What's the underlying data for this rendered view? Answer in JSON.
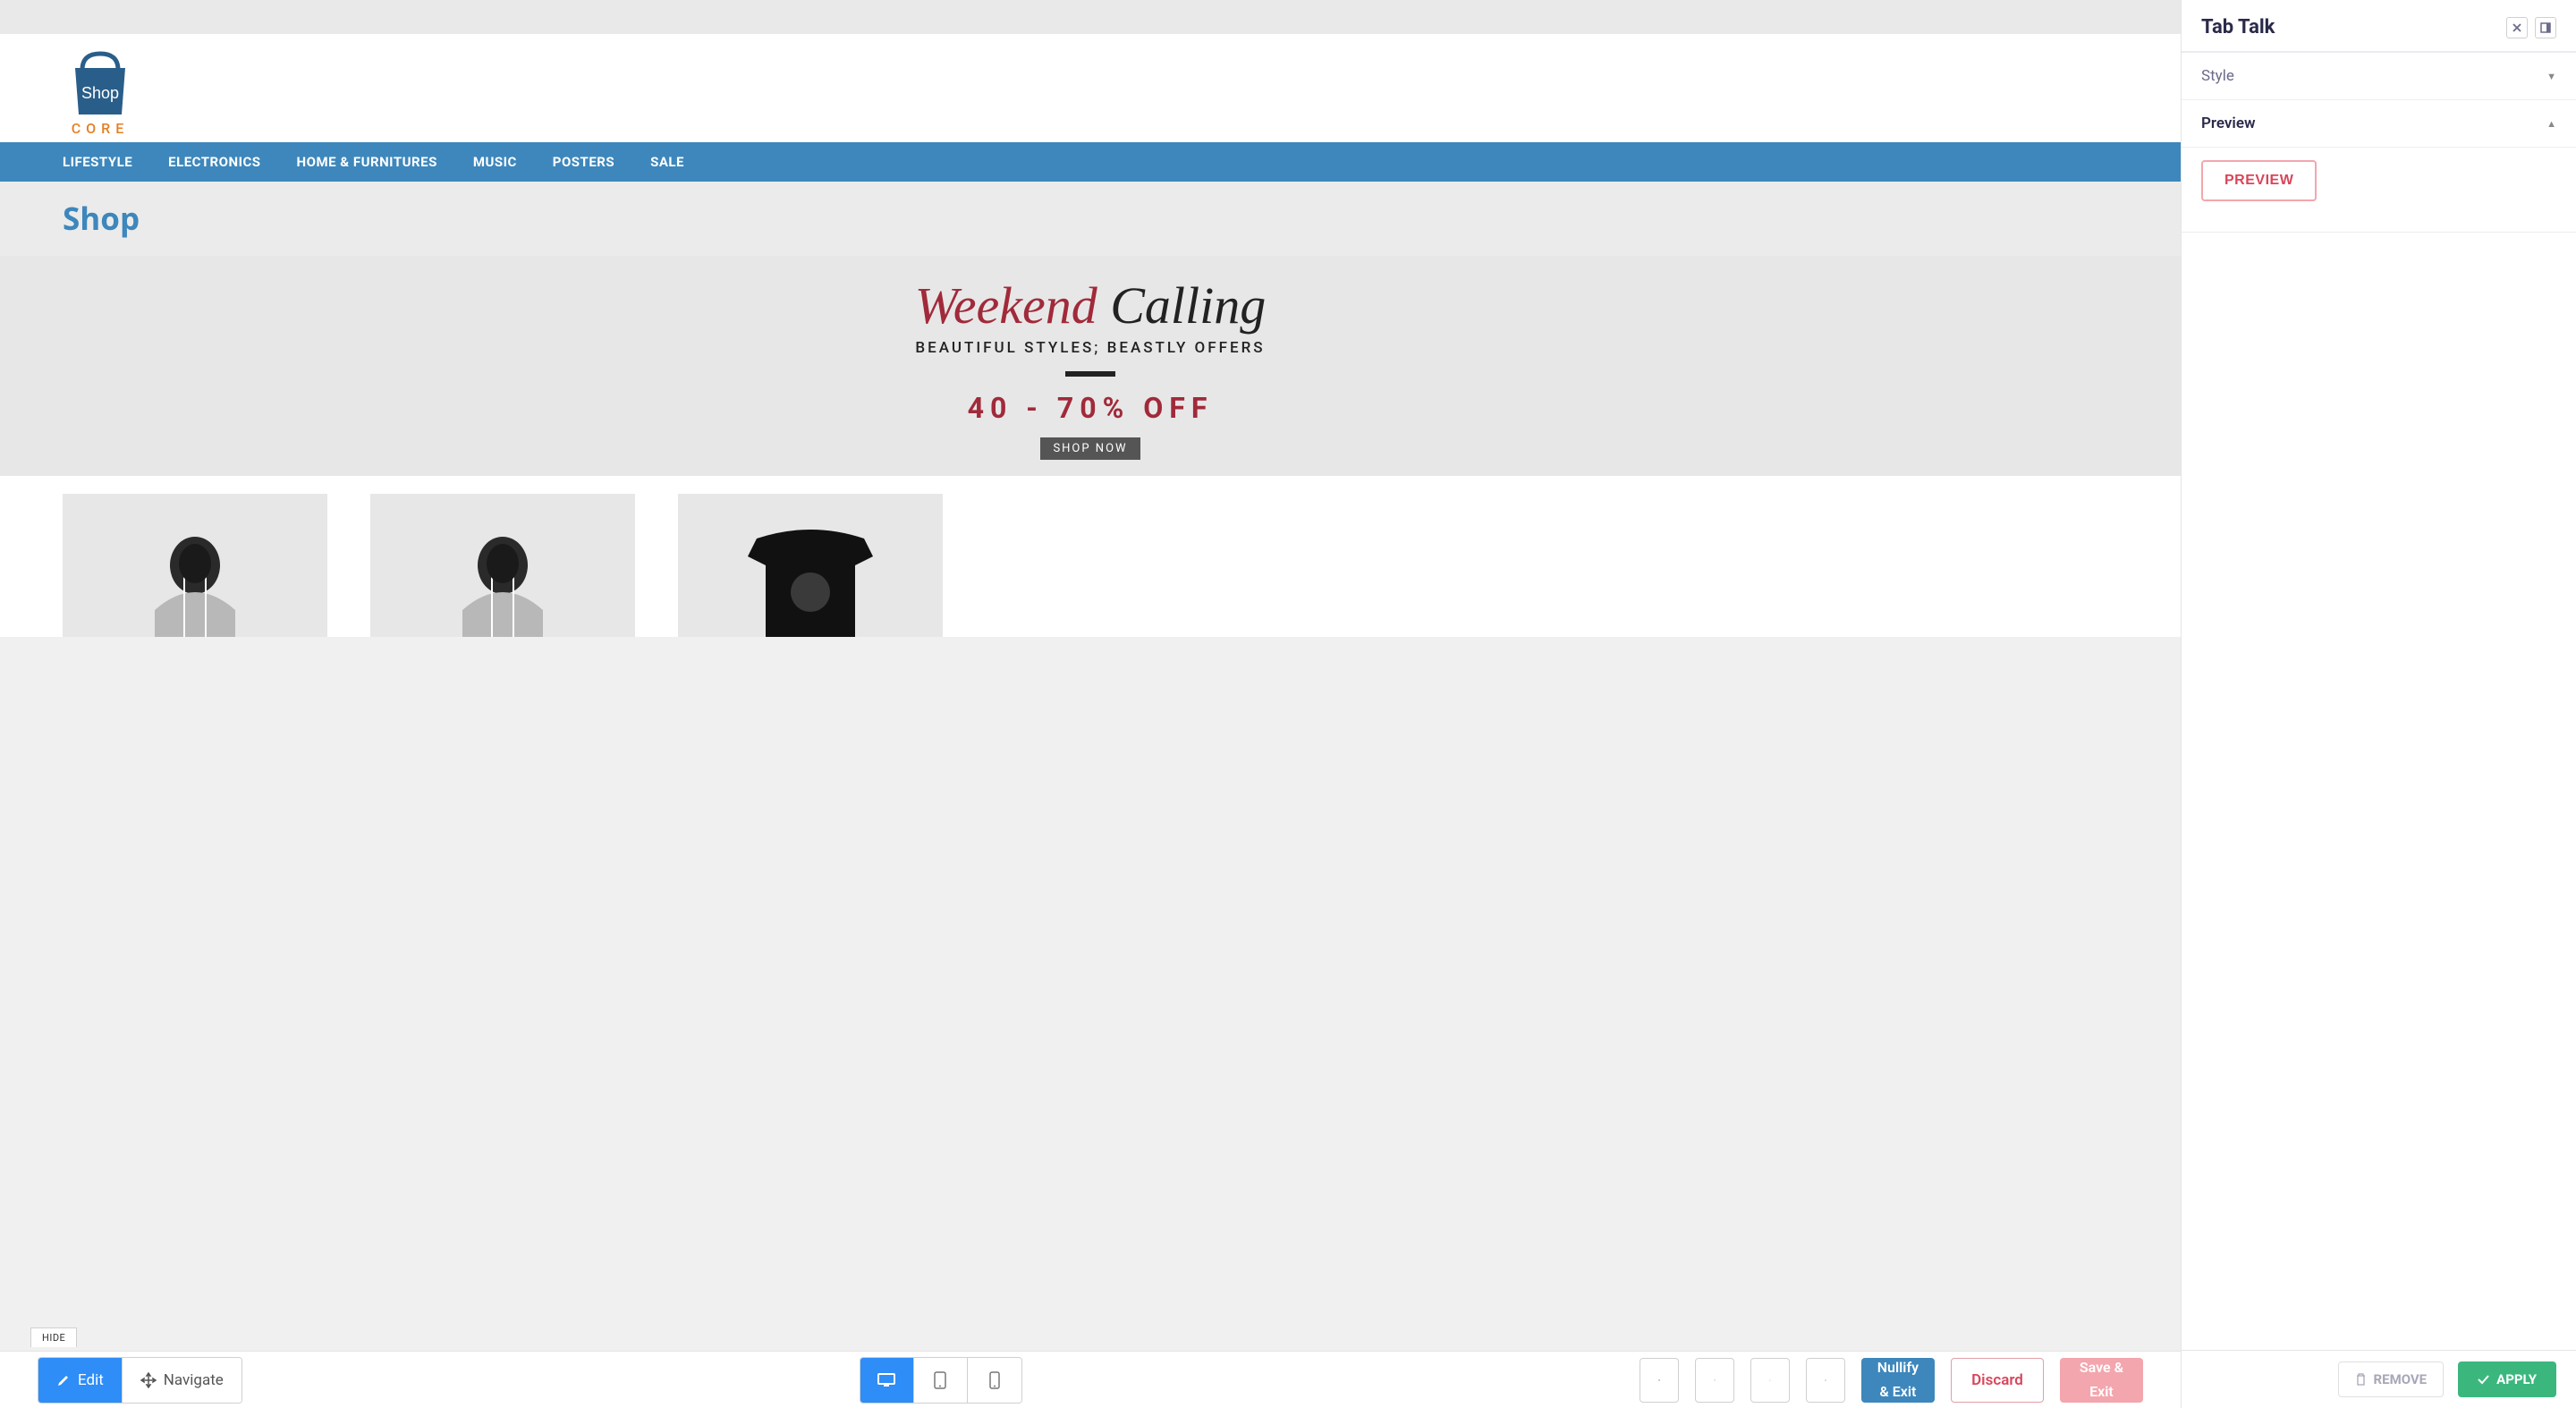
{
  "site": {
    "logo_top": "Shop",
    "logo_bottom": "CORE",
    "nav": [
      "LIFESTYLE",
      "ELECTRONICS",
      "HOME & FURNITURES",
      "MUSIC",
      "POSTERS",
      "SALE"
    ],
    "page_title": "Shop",
    "banner": {
      "script_left": "Weekend",
      "script_right": "Calling",
      "subtitle": "BEAUTIFUL STYLES; BEASTLY OFFERS",
      "discount": "40 - 70% OFF",
      "cta": "SHOP NOW"
    }
  },
  "hide_tab": "HIDE",
  "toolbar": {
    "edit": "Edit",
    "navigate": "Navigate",
    "nullify_l1": "Nullify",
    "nullify_l2": "& Exit",
    "discard": "Discard",
    "save_l1": "Save &",
    "save_l2": "Exit"
  },
  "panel": {
    "title": "Tab Talk",
    "sections": {
      "style": "Style",
      "preview": "Preview"
    },
    "preview_button": "PREVIEW",
    "remove": "REMOVE",
    "apply": "APPLY"
  }
}
